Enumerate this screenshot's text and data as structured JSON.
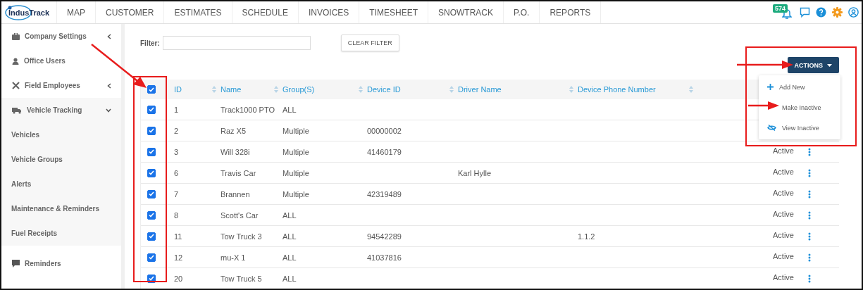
{
  "logo": {
    "text": "IndusTrack"
  },
  "nav": [
    {
      "label": "MAP"
    },
    {
      "label": "CUSTOMER"
    },
    {
      "label": "ESTIMATES"
    },
    {
      "label": "SCHEDULE"
    },
    {
      "label": "INVOICES"
    },
    {
      "label": "TIMESHEET"
    },
    {
      "label": "SNOWTRACK"
    },
    {
      "label": "P.O."
    },
    {
      "label": "REPORTS"
    }
  ],
  "notification_badge": "574",
  "sidebar": {
    "items": [
      {
        "label": "Company Settings",
        "expanded": false,
        "sub": false
      },
      {
        "label": "Office Users",
        "sub": false
      },
      {
        "label": "Field Employees",
        "expanded": false,
        "sub": false
      },
      {
        "label": "Vehicle Tracking",
        "expanded": true,
        "sub": false
      },
      {
        "label": "Vehicles",
        "sub": true
      },
      {
        "label": "Vehicle Groups",
        "sub": true
      },
      {
        "label": "Alerts",
        "sub": true
      },
      {
        "label": "Maintenance & Reminders",
        "sub": true
      },
      {
        "label": "Fuel Receipts",
        "sub": true
      },
      {
        "label": "Reminders",
        "sub": false
      }
    ]
  },
  "filter": {
    "label": "Filter:"
  },
  "clear_filter_button": "CLEAR FILTER",
  "actions_button": "ACTIONS",
  "actions_menu": [
    {
      "label": "Add New"
    },
    {
      "label": "Make Inactive"
    },
    {
      "label": "View Inactive"
    }
  ],
  "table": {
    "select_all": true,
    "columns": [
      {
        "label": "ID"
      },
      {
        "label": "Name"
      },
      {
        "label": "Group(S)"
      },
      {
        "label": "Device ID"
      },
      {
        "label": "Driver Name"
      },
      {
        "label": "Device Phone Number"
      }
    ],
    "rows": [
      {
        "checked": true,
        "cells": [
          "1",
          "Track1000 PTO",
          "ALL",
          "",
          "",
          ""
        ]
      },
      {
        "checked": true,
        "cells": [
          "2",
          "Raz X5",
          "Multiple",
          "00000002",
          "",
          ""
        ]
      },
      {
        "checked": true,
        "cells": [
          "3",
          "Will 328i",
          "Multiple",
          "41460179",
          "",
          ""
        ],
        "status": "Active"
      },
      {
        "checked": true,
        "cells": [
          "6",
          "Travis Car",
          "Multiple",
          "",
          "Karl Hylle",
          ""
        ],
        "status": "Active"
      },
      {
        "checked": true,
        "cells": [
          "7",
          "Brannen",
          "Multiple",
          "42319489",
          "",
          ""
        ],
        "status": "Active"
      },
      {
        "checked": true,
        "cells": [
          "8",
          "Scott's Car",
          "ALL",
          "",
          "",
          ""
        ],
        "status": "Active"
      },
      {
        "checked": true,
        "cells": [
          "11",
          "Tow Truck 3",
          "ALL",
          "94542289",
          "",
          "1.1.2"
        ],
        "status": "Active"
      },
      {
        "checked": true,
        "cells": [
          "12",
          "mu-X 1",
          "ALL",
          "41037816",
          "",
          ""
        ],
        "status": "Active"
      },
      {
        "checked": true,
        "cells": [
          "20",
          "Tow Truck 5",
          "ALL",
          "",
          "",
          ""
        ],
        "status": "Active"
      }
    ]
  }
}
